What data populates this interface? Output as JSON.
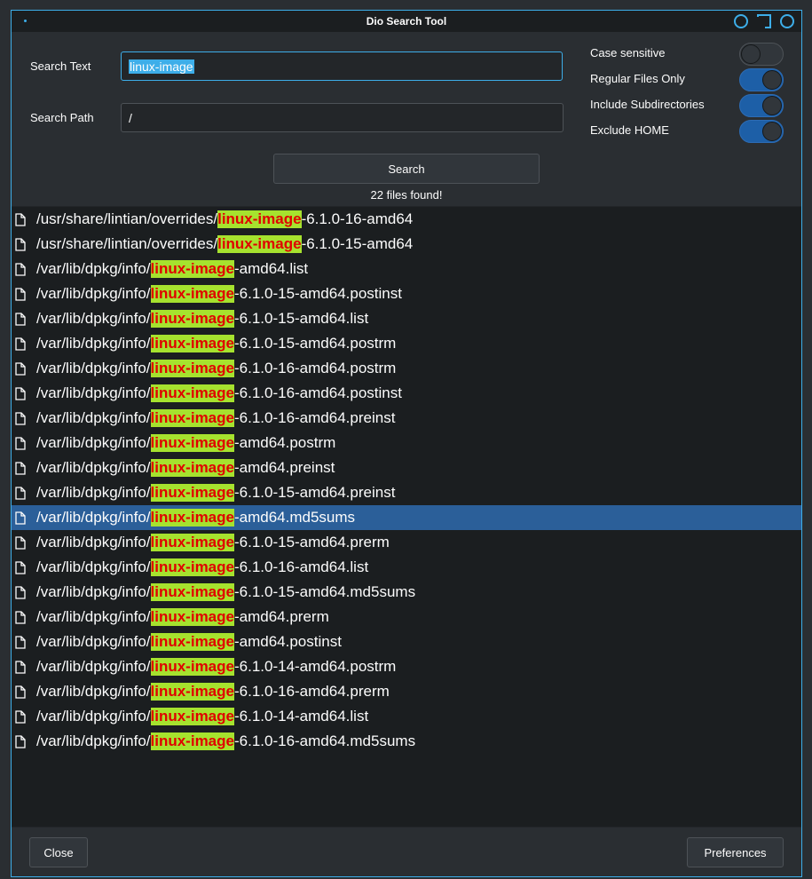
{
  "window": {
    "title": "Dio Search Tool"
  },
  "form": {
    "search_text_label": "Search Text",
    "search_text_value": "linux-image",
    "search_path_label": "Search Path",
    "search_path_value": "/"
  },
  "options": [
    {
      "label": "Case sensitive",
      "on": false
    },
    {
      "label": "Regular Files Only",
      "on": true
    },
    {
      "label": "Include Subdirectories",
      "on": true
    },
    {
      "label": "Exclude HOME",
      "on": true
    }
  ],
  "search_button": "Search",
  "status": "22 files found!",
  "highlight_term": "linux-image",
  "results": [
    {
      "prefix": "/usr/share/lintian/overrides/",
      "match": "linux-image",
      "suffix": "-6.1.0-16-amd64"
    },
    {
      "prefix": "/usr/share/lintian/overrides/",
      "match": "linux-image",
      "suffix": "-6.1.0-15-amd64"
    },
    {
      "prefix": "/var/lib/dpkg/info/",
      "match": "linux-image",
      "suffix": "-amd64.list"
    },
    {
      "prefix": "/var/lib/dpkg/info/",
      "match": "linux-image",
      "suffix": "-6.1.0-15-amd64.postinst"
    },
    {
      "prefix": "/var/lib/dpkg/info/",
      "match": "linux-image",
      "suffix": "-6.1.0-15-amd64.list"
    },
    {
      "prefix": "/var/lib/dpkg/info/",
      "match": "linux-image",
      "suffix": "-6.1.0-15-amd64.postrm"
    },
    {
      "prefix": "/var/lib/dpkg/info/",
      "match": "linux-image",
      "suffix": "-6.1.0-16-amd64.postrm"
    },
    {
      "prefix": "/var/lib/dpkg/info/",
      "match": "linux-image",
      "suffix": "-6.1.0-16-amd64.postinst"
    },
    {
      "prefix": "/var/lib/dpkg/info/",
      "match": "linux-image",
      "suffix": "-6.1.0-16-amd64.preinst"
    },
    {
      "prefix": "/var/lib/dpkg/info/",
      "match": "linux-image",
      "suffix": "-amd64.postrm"
    },
    {
      "prefix": "/var/lib/dpkg/info/",
      "match": "linux-image",
      "suffix": "-amd64.preinst"
    },
    {
      "prefix": "/var/lib/dpkg/info/",
      "match": "linux-image",
      "suffix": "-6.1.0-15-amd64.preinst"
    },
    {
      "prefix": "/var/lib/dpkg/info/",
      "match": "linux-image",
      "suffix": "-amd64.md5sums",
      "selected": true
    },
    {
      "prefix": "/var/lib/dpkg/info/",
      "match": "linux-image",
      "suffix": "-6.1.0-15-amd64.prerm"
    },
    {
      "prefix": "/var/lib/dpkg/info/",
      "match": "linux-image",
      "suffix": "-6.1.0-16-amd64.list"
    },
    {
      "prefix": "/var/lib/dpkg/info/",
      "match": "linux-image",
      "suffix": "-6.1.0-15-amd64.md5sums"
    },
    {
      "prefix": "/var/lib/dpkg/info/",
      "match": "linux-image",
      "suffix": "-amd64.prerm"
    },
    {
      "prefix": "/var/lib/dpkg/info/",
      "match": "linux-image",
      "suffix": "-amd64.postinst"
    },
    {
      "prefix": "/var/lib/dpkg/info/",
      "match": "linux-image",
      "suffix": "-6.1.0-14-amd64.postrm"
    },
    {
      "prefix": "/var/lib/dpkg/info/",
      "match": "linux-image",
      "suffix": "-6.1.0-16-amd64.prerm"
    },
    {
      "prefix": "/var/lib/dpkg/info/",
      "match": "linux-image",
      "suffix": "-6.1.0-14-amd64.list"
    },
    {
      "prefix": "/var/lib/dpkg/info/",
      "match": "linux-image",
      "suffix": "-6.1.0-16-amd64.md5sums"
    }
  ],
  "footer": {
    "close_label": "Close",
    "preferences_label": "Preferences"
  },
  "colors": {
    "accent": "#3daee9",
    "selection": "#2b5f99",
    "highlight_bg": "#a6e22e",
    "highlight_fg": "#e00000",
    "toggle_on": "#1d5fa7"
  },
  "icons": {
    "file": "file-icon"
  }
}
